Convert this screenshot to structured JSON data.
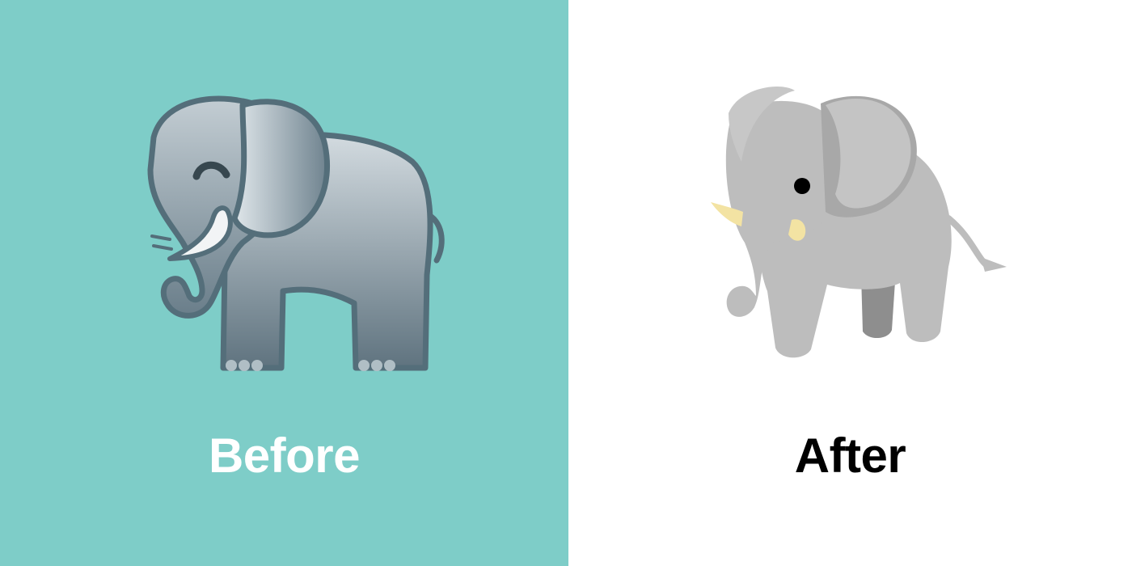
{
  "before": {
    "label": "Before",
    "background": "#7ecdc8",
    "label_color": "#ffffff",
    "illustration": "elephant-emoji-old-design"
  },
  "after": {
    "label": "After",
    "background": "#ffffff",
    "label_color": "#000000",
    "illustration": "elephant-emoji-new-design"
  }
}
